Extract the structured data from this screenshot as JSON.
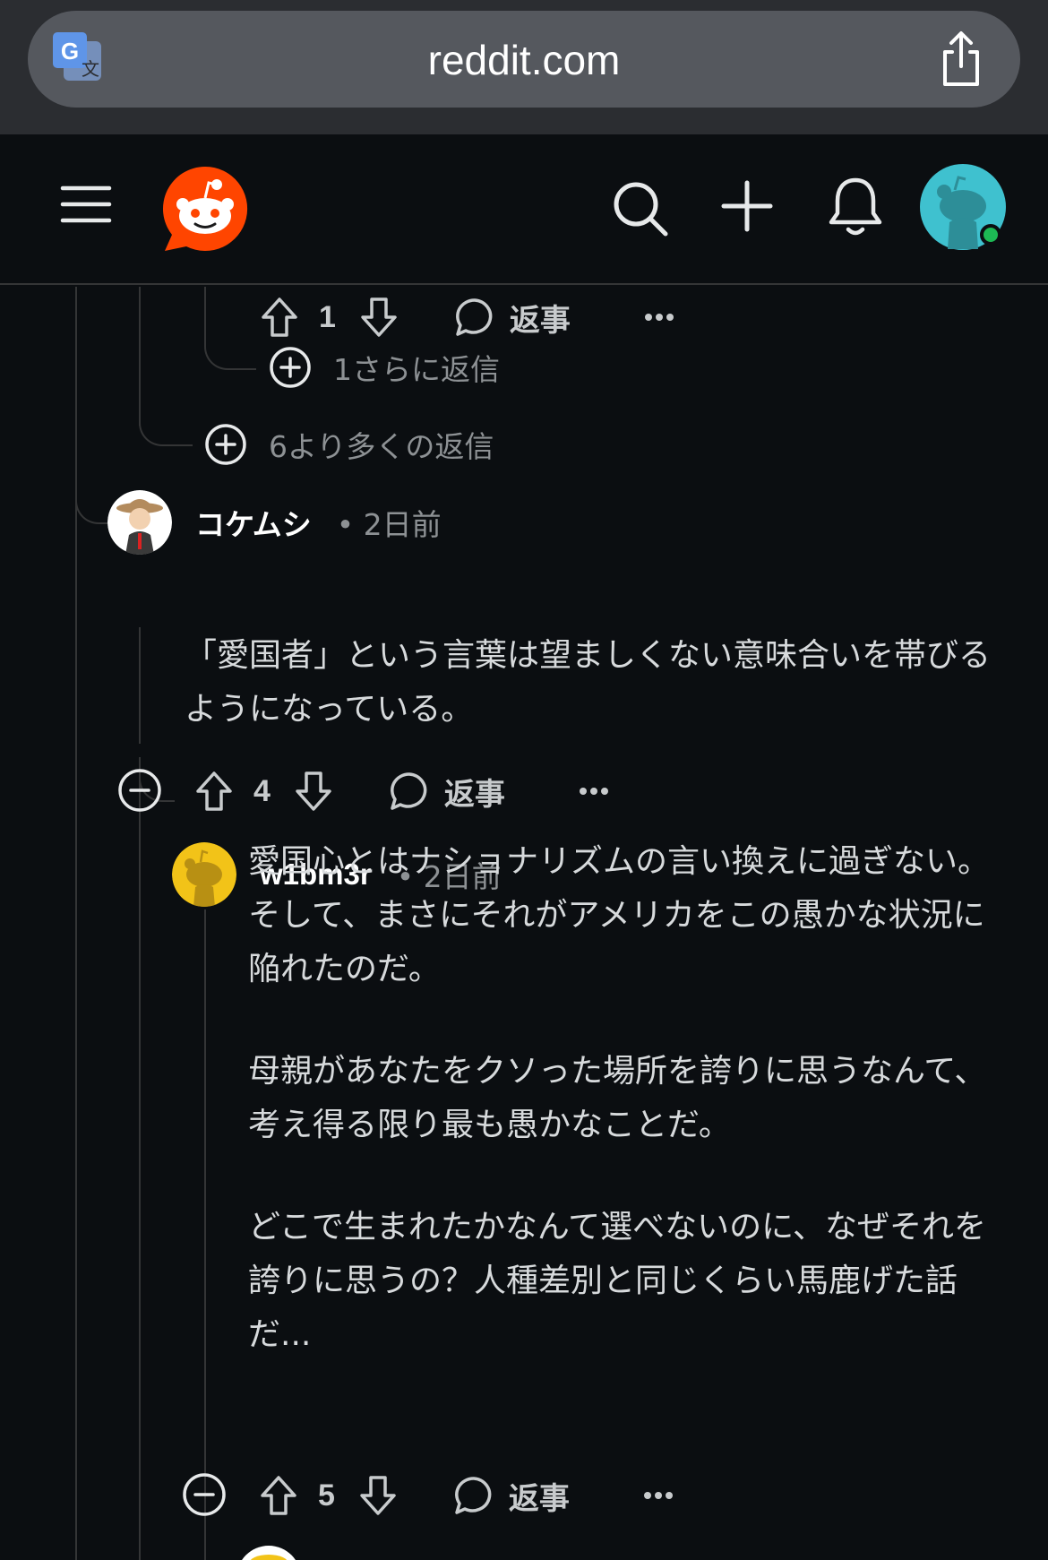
{
  "browser": {
    "url": "reddit.com",
    "translate_icon": "google-translate-icon",
    "share_icon": "share-icon"
  },
  "header": {
    "menu_icon": "hamburger-menu-icon",
    "logo_icon": "reddit-logo",
    "search_icon": "search-icon",
    "create_icon": "plus-icon",
    "notifications_icon": "bell-icon",
    "avatar_icon": "user-avatar",
    "online_color": "#1db954"
  },
  "thread": {
    "top_actions": {
      "votes": "1",
      "reply_label": "返事"
    },
    "more_replies_nested": "1さらに返信",
    "more_replies": "6より多くの返信",
    "comments": [
      {
        "author": "コケムシ",
        "time": "• 2日前",
        "body": [
          "「愛国者」という言葉は望ましくない意味合いを帯びるようになっている。"
        ],
        "votes": "4",
        "reply_label": "返事"
      },
      {
        "author": "w1bm3r",
        "time": "• 2日前",
        "body": [
          "愛国心とはナショナリズムの言い換えに過ぎない。そして、まさにそれがアメリカをこの愚かな状況に陥れたのだ。",
          "母親があなたをクソった場所を誇りに思うなんて、考え得る限り最も愚かなことだ。",
          "どこで生まれたかなんて選べないのに、なぜそれを誇りに思うの？人種差別と同じくらい馬鹿げた話だ..."
        ],
        "votes": "5",
        "reply_label": "返事"
      }
    ]
  },
  "colors": {
    "background": "#0b0e11",
    "reddit_orange": "#ff4500",
    "avatar_teal": "#3fc1cf",
    "avatar_yellow": "#f2c318"
  }
}
